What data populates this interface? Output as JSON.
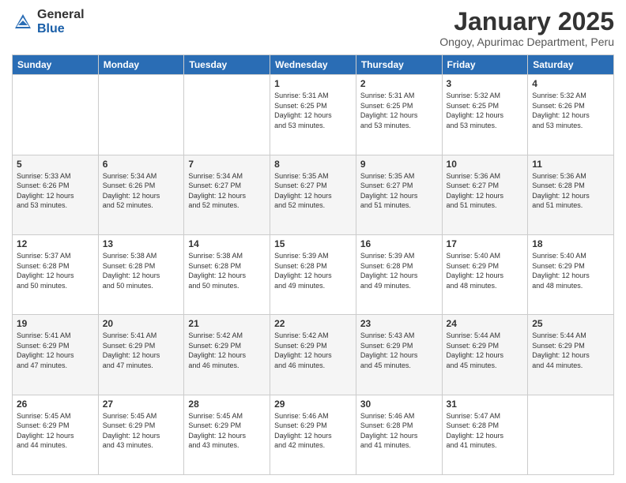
{
  "logo": {
    "general": "General",
    "blue": "Blue"
  },
  "title": "January 2025",
  "subtitle": "Ongoy, Apurimac Department, Peru",
  "days_of_week": [
    "Sunday",
    "Monday",
    "Tuesday",
    "Wednesday",
    "Thursday",
    "Friday",
    "Saturday"
  ],
  "weeks": [
    [
      {
        "day": "",
        "info": ""
      },
      {
        "day": "",
        "info": ""
      },
      {
        "day": "",
        "info": ""
      },
      {
        "day": "1",
        "info": "Sunrise: 5:31 AM\nSunset: 6:25 PM\nDaylight: 12 hours\nand 53 minutes."
      },
      {
        "day": "2",
        "info": "Sunrise: 5:31 AM\nSunset: 6:25 PM\nDaylight: 12 hours\nand 53 minutes."
      },
      {
        "day": "3",
        "info": "Sunrise: 5:32 AM\nSunset: 6:25 PM\nDaylight: 12 hours\nand 53 minutes."
      },
      {
        "day": "4",
        "info": "Sunrise: 5:32 AM\nSunset: 6:26 PM\nDaylight: 12 hours\nand 53 minutes."
      }
    ],
    [
      {
        "day": "5",
        "info": "Sunrise: 5:33 AM\nSunset: 6:26 PM\nDaylight: 12 hours\nand 53 minutes."
      },
      {
        "day": "6",
        "info": "Sunrise: 5:34 AM\nSunset: 6:26 PM\nDaylight: 12 hours\nand 52 minutes."
      },
      {
        "day": "7",
        "info": "Sunrise: 5:34 AM\nSunset: 6:27 PM\nDaylight: 12 hours\nand 52 minutes."
      },
      {
        "day": "8",
        "info": "Sunrise: 5:35 AM\nSunset: 6:27 PM\nDaylight: 12 hours\nand 52 minutes."
      },
      {
        "day": "9",
        "info": "Sunrise: 5:35 AM\nSunset: 6:27 PM\nDaylight: 12 hours\nand 51 minutes."
      },
      {
        "day": "10",
        "info": "Sunrise: 5:36 AM\nSunset: 6:27 PM\nDaylight: 12 hours\nand 51 minutes."
      },
      {
        "day": "11",
        "info": "Sunrise: 5:36 AM\nSunset: 6:28 PM\nDaylight: 12 hours\nand 51 minutes."
      }
    ],
    [
      {
        "day": "12",
        "info": "Sunrise: 5:37 AM\nSunset: 6:28 PM\nDaylight: 12 hours\nand 50 minutes."
      },
      {
        "day": "13",
        "info": "Sunrise: 5:38 AM\nSunset: 6:28 PM\nDaylight: 12 hours\nand 50 minutes."
      },
      {
        "day": "14",
        "info": "Sunrise: 5:38 AM\nSunset: 6:28 PM\nDaylight: 12 hours\nand 50 minutes."
      },
      {
        "day": "15",
        "info": "Sunrise: 5:39 AM\nSunset: 6:28 PM\nDaylight: 12 hours\nand 49 minutes."
      },
      {
        "day": "16",
        "info": "Sunrise: 5:39 AM\nSunset: 6:28 PM\nDaylight: 12 hours\nand 49 minutes."
      },
      {
        "day": "17",
        "info": "Sunrise: 5:40 AM\nSunset: 6:29 PM\nDaylight: 12 hours\nand 48 minutes."
      },
      {
        "day": "18",
        "info": "Sunrise: 5:40 AM\nSunset: 6:29 PM\nDaylight: 12 hours\nand 48 minutes."
      }
    ],
    [
      {
        "day": "19",
        "info": "Sunrise: 5:41 AM\nSunset: 6:29 PM\nDaylight: 12 hours\nand 47 minutes."
      },
      {
        "day": "20",
        "info": "Sunrise: 5:41 AM\nSunset: 6:29 PM\nDaylight: 12 hours\nand 47 minutes."
      },
      {
        "day": "21",
        "info": "Sunrise: 5:42 AM\nSunset: 6:29 PM\nDaylight: 12 hours\nand 46 minutes."
      },
      {
        "day": "22",
        "info": "Sunrise: 5:42 AM\nSunset: 6:29 PM\nDaylight: 12 hours\nand 46 minutes."
      },
      {
        "day": "23",
        "info": "Sunrise: 5:43 AM\nSunset: 6:29 PM\nDaylight: 12 hours\nand 45 minutes."
      },
      {
        "day": "24",
        "info": "Sunrise: 5:44 AM\nSunset: 6:29 PM\nDaylight: 12 hours\nand 45 minutes."
      },
      {
        "day": "25",
        "info": "Sunrise: 5:44 AM\nSunset: 6:29 PM\nDaylight: 12 hours\nand 44 minutes."
      }
    ],
    [
      {
        "day": "26",
        "info": "Sunrise: 5:45 AM\nSunset: 6:29 PM\nDaylight: 12 hours\nand 44 minutes."
      },
      {
        "day": "27",
        "info": "Sunrise: 5:45 AM\nSunset: 6:29 PM\nDaylight: 12 hours\nand 43 minutes."
      },
      {
        "day": "28",
        "info": "Sunrise: 5:45 AM\nSunset: 6:29 PM\nDaylight: 12 hours\nand 43 minutes."
      },
      {
        "day": "29",
        "info": "Sunrise: 5:46 AM\nSunset: 6:29 PM\nDaylight: 12 hours\nand 42 minutes."
      },
      {
        "day": "30",
        "info": "Sunrise: 5:46 AM\nSunset: 6:28 PM\nDaylight: 12 hours\nand 41 minutes."
      },
      {
        "day": "31",
        "info": "Sunrise: 5:47 AM\nSunset: 6:28 PM\nDaylight: 12 hours\nand 41 minutes."
      },
      {
        "day": "",
        "info": ""
      }
    ]
  ]
}
